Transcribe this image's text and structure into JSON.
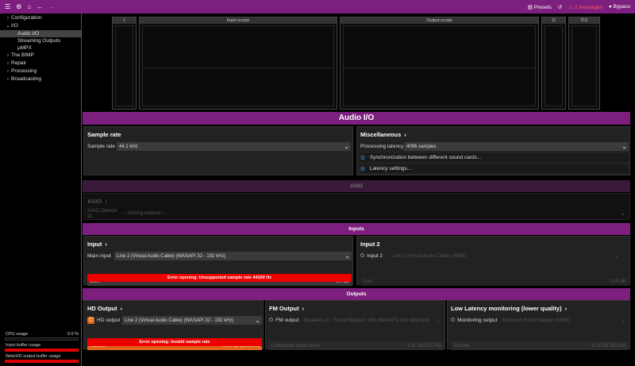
{
  "topbar": {
    "presets": "Presets",
    "messages": "2 messages",
    "bypass": "Bypass"
  },
  "tree": [
    {
      "label": "Configuration",
      "level": 0,
      "expanded": false
    },
    {
      "label": "I/O",
      "level": 0,
      "expanded": true
    },
    {
      "label": "Audio I/O",
      "level": 1,
      "selected": true
    },
    {
      "label": "Streaming Outputs",
      "level": 1
    },
    {
      "label": "µMPX",
      "level": 1
    },
    {
      "label": "The BIMP",
      "level": 0,
      "expanded": false
    },
    {
      "label": "Repair",
      "level": 0,
      "expanded": false
    },
    {
      "label": "Processing",
      "level": 0,
      "expanded": false
    },
    {
      "label": "Broadcasting",
      "level": 0,
      "expanded": false
    }
  ],
  "meters": {
    "cpu_label": "CPU usage",
    "cpu_value": "0.0 %",
    "input_buffer": "Input buffer usage",
    "output_buffer": "Web/HD output buffer usage"
  },
  "scopes": {
    "i": "I",
    "input": "Input scope",
    "output": "Output scope",
    "o": "O",
    "itu": "ITU"
  },
  "page_title": "Audio I/O",
  "sample_rate": {
    "title": "Sample rate",
    "label": "Sample rate",
    "value": "44.1 kHz"
  },
  "misc": {
    "title": "Miscellaneous",
    "latency_label": "Processing latency",
    "latency_value": "4096 samples",
    "sync": "Synchronization between different sound cards...",
    "latency_settings": "Latency settings..."
  },
  "asio": {
    "section": "ASIO",
    "title": "ASIO",
    "device_label": "ASIO Device ID",
    "device_value": "-- nothing entered --"
  },
  "inputs": {
    "section": "Inputs",
    "input": {
      "title": "Input",
      "main_label": "Main input",
      "main_value": "Line 2 (Virtual Audio Cable) (WASAPI 32 - 192 kHz)",
      "gain_label": "Gain",
      "gain_value": "0.0 dB",
      "error": "Error opening: Unsupported sample rate 44100 Hz"
    },
    "input2": {
      "title": "Input 2",
      "label": "Input 2",
      "value": "Line 1 (Virtual Audio Cable) (MME)",
      "gain_label": "Gain",
      "gain_value": "0.00 dB"
    }
  },
  "outputs": {
    "section": "Outputs",
    "hd": {
      "title": "HD Output",
      "label": "HD output",
      "value": "Line 2 (Virtual Audio Cable) (WASAPI 32 - 192 kHz)",
      "vol_label": "Volume",
      "vol_value": "0.00 dB (100.0%)",
      "error": "Error opening: Invalid sample rate"
    },
    "fm": {
      "title": "FM Output",
      "label": "FM output",
      "value": "Speakers (2 - Sound BlasterX G6) (WASAPI) (not detected)",
      "level_label": "Composite output level",
      "level_value": "1.01 dB (70.7%)"
    },
    "ll": {
      "title": "Low Latency monitoring (lower quality)",
      "label": "Monitoring output",
      "value": "Microsoft Sound Mapper (MME)",
      "vol_label": "Volume",
      "vol_value": "-6.02 dB (50.0%)"
    }
  }
}
